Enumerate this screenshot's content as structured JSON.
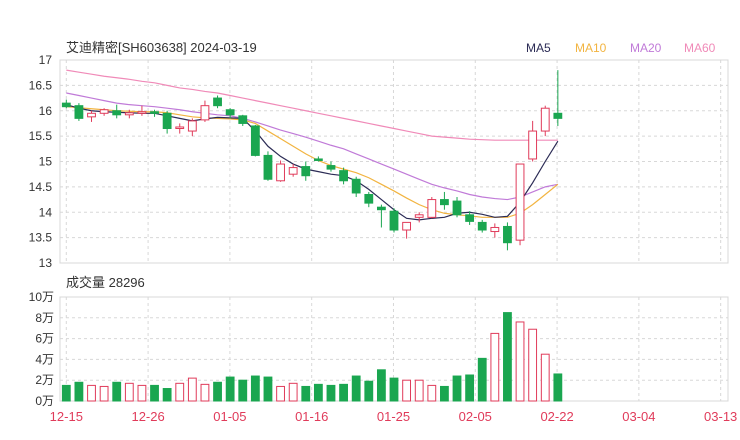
{
  "header": {
    "title": "艾迪精密[SH603638] 2024-03-19",
    "legend": [
      {
        "label": "MA5",
        "color": "#2b2b55"
      },
      {
        "label": "MA10",
        "color": "#f2b440"
      },
      {
        "label": "MA20",
        "color": "#c07ad8"
      },
      {
        "label": "MA60",
        "color": "#f08ab8"
      }
    ]
  },
  "colors": {
    "up": "#e03b5a",
    "down": "#1aa650",
    "grid": "#d8d8d8",
    "axis": "#333333",
    "date": "#e03b5a"
  },
  "chart_data": [
    {
      "type": "candlestick",
      "ylim": [
        13,
        17
      ],
      "yticks": [
        "13",
        "13.5",
        "14",
        "14.5",
        "15",
        "15.5",
        "16",
        "16.5",
        "17"
      ],
      "xticks": [
        {
          "index": 0,
          "label": "12-15"
        },
        {
          "index": 6,
          "label": "12-26"
        },
        {
          "index": 12,
          "label": "01-05"
        },
        {
          "index": 18,
          "label": "01-16"
        },
        {
          "index": 24,
          "label": "01-25"
        },
        {
          "index": 30,
          "label": "02-05"
        },
        {
          "index": 36,
          "label": "02-22"
        },
        {
          "index": 42,
          "label": "03-04"
        },
        {
          "index": 48,
          "label": "03-13"
        }
      ],
      "ohlc": [
        [
          16.15,
          16.22,
          16.05,
          16.08
        ],
        [
          16.1,
          16.15,
          15.8,
          15.85
        ],
        [
          15.88,
          16.0,
          15.78,
          15.95
        ],
        [
          15.95,
          16.05,
          15.9,
          16.02
        ],
        [
          16.0,
          16.12,
          15.85,
          15.92
        ],
        [
          15.92,
          16.02,
          15.85,
          15.96
        ],
        [
          15.95,
          16.1,
          15.9,
          15.98
        ],
        [
          15.98,
          16.02,
          15.88,
          15.95
        ],
        [
          15.95,
          16.0,
          15.55,
          15.65
        ],
        [
          15.65,
          15.75,
          15.55,
          15.68
        ],
        [
          15.6,
          15.85,
          15.5,
          15.8
        ],
        [
          15.82,
          16.2,
          15.78,
          16.1
        ],
        [
          16.25,
          16.3,
          16.05,
          16.1
        ],
        [
          16.02,
          16.05,
          15.85,
          15.92
        ],
        [
          15.9,
          15.92,
          15.7,
          15.75
        ],
        [
          15.7,
          15.72,
          15.1,
          15.12
        ],
        [
          15.12,
          15.2,
          14.62,
          14.65
        ],
        [
          14.62,
          15.02,
          14.6,
          14.95
        ],
        [
          14.75,
          14.95,
          14.7,
          14.88
        ],
        [
          14.9,
          15.0,
          14.62,
          14.72
        ],
        [
          15.05,
          15.1,
          15.0,
          15.02
        ],
        [
          14.92,
          15.0,
          14.8,
          14.85
        ],
        [
          14.82,
          14.88,
          14.55,
          14.62
        ],
        [
          14.65,
          14.7,
          14.3,
          14.38
        ],
        [
          14.35,
          14.4,
          14.1,
          14.18
        ],
        [
          14.1,
          14.15,
          13.7,
          14.05
        ],
        [
          14.02,
          14.08,
          13.6,
          13.65
        ],
        [
          13.65,
          13.8,
          13.48,
          13.8
        ],
        [
          13.9,
          14.0,
          13.8,
          13.95
        ],
        [
          13.9,
          14.3,
          13.88,
          14.25
        ],
        [
          14.25,
          14.4,
          14.05,
          14.15
        ],
        [
          14.22,
          14.3,
          13.9,
          13.95
        ],
        [
          13.95,
          14.02,
          13.75,
          13.82
        ],
        [
          13.8,
          13.85,
          13.6,
          13.65
        ],
        [
          13.62,
          13.78,
          13.5,
          13.7
        ],
        [
          13.72,
          13.8,
          13.25,
          13.4
        ],
        [
          13.45,
          14.95,
          13.35,
          14.95
        ],
        [
          15.05,
          15.8,
          15.0,
          15.6
        ],
        [
          15.6,
          16.1,
          15.5,
          16.05
        ],
        [
          15.95,
          16.8,
          15.7,
          15.85
        ]
      ],
      "ma_series_note": "",
      "ma5": [
        16.12,
        16.05,
        16.0,
        15.98,
        15.97,
        15.96,
        15.95,
        15.95,
        15.9,
        15.85,
        15.8,
        15.84,
        15.87,
        15.86,
        15.85,
        15.6,
        15.3,
        15.1,
        14.95,
        14.85,
        14.8,
        14.75,
        14.72,
        14.62,
        14.45,
        14.25,
        14.05,
        13.88,
        13.85,
        13.88,
        13.9,
        13.98,
        14.0,
        13.96,
        13.9,
        13.92,
        14.2,
        14.58,
        15.0,
        15.4
      ],
      "ma10": [
        16.08,
        16.06,
        16.04,
        16.02,
        16.0,
        15.99,
        15.98,
        15.98,
        15.96,
        15.92,
        15.88,
        15.86,
        15.85,
        15.84,
        15.82,
        15.75,
        15.6,
        15.45,
        15.3,
        15.15,
        15.02,
        14.92,
        14.85,
        14.78,
        14.68,
        14.55,
        14.42,
        14.28,
        14.15,
        14.05,
        13.98,
        13.95,
        13.93,
        13.9,
        13.9,
        13.9,
        13.98,
        14.15,
        14.35,
        14.55
      ],
      "ma20": [
        16.35,
        16.3,
        16.25,
        16.2,
        16.15,
        16.12,
        16.1,
        16.08,
        16.05,
        16.02,
        15.98,
        15.95,
        15.92,
        15.9,
        15.85,
        15.78,
        15.7,
        15.62,
        15.55,
        15.48,
        15.4,
        15.32,
        15.25,
        15.15,
        15.05,
        14.95,
        14.85,
        14.75,
        14.65,
        14.55,
        14.48,
        14.42,
        14.35,
        14.3,
        14.27,
        14.25,
        14.3,
        14.4,
        14.5,
        14.55
      ],
      "ma60": [
        16.8,
        16.76,
        16.72,
        16.68,
        16.65,
        16.62,
        16.58,
        16.55,
        16.5,
        16.45,
        16.42,
        16.38,
        16.35,
        16.3,
        16.25,
        16.2,
        16.15,
        16.1,
        16.05,
        16.0,
        15.95,
        15.9,
        15.85,
        15.8,
        15.75,
        15.7,
        15.65,
        15.6,
        15.55,
        15.5,
        15.48,
        15.46,
        15.44,
        15.43,
        15.42,
        15.42,
        15.42,
        15.42,
        15.42,
        15.42
      ]
    },
    {
      "type": "bar",
      "title": "成交量 28296",
      "ylim": [
        0,
        10
      ],
      "yticks": [
        "0万",
        "2万",
        "4万",
        "6万",
        "8万",
        "10万"
      ],
      "values": [
        1.5,
        1.8,
        1.5,
        1.4,
        1.8,
        1.7,
        1.5,
        1.5,
        1.2,
        1.7,
        2.2,
        1.6,
        1.8,
        2.3,
        2.0,
        2.4,
        2.3,
        1.4,
        1.7,
        1.4,
        1.6,
        1.5,
        1.6,
        2.4,
        1.9,
        3.0,
        2.2,
        2.0,
        2.0,
        1.5,
        1.4,
        2.4,
        2.5,
        4.1,
        6.5,
        8.5,
        7.6,
        6.9,
        4.5,
        2.6
      ]
    }
  ]
}
